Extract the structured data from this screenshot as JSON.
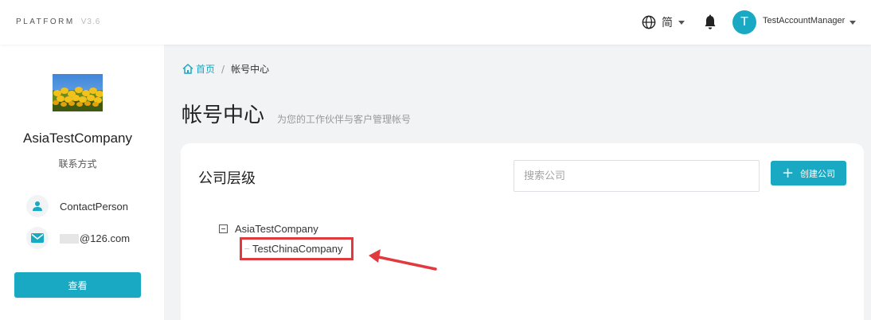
{
  "header": {
    "brand": "PLATFORM",
    "version": "V3.6",
    "language": "简",
    "language_icon": "globe-icon",
    "notification_icon": "bell-icon",
    "avatar_initial": "T",
    "username": "TestAccountManager"
  },
  "sidebar": {
    "company_name": "AsiaTestCompany",
    "contact_title": "联系方式",
    "contact_person": "ContactPerson",
    "email": "@126.com",
    "view_button": "查看",
    "person_icon": "person-icon",
    "email_icon": "mail-icon"
  },
  "breadcrumb": {
    "home": "首页",
    "separator": "/",
    "current": "帐号中心"
  },
  "page": {
    "title": "帐号中心",
    "subtitle": "为您的工作伙伴与客户管理帐号"
  },
  "card": {
    "title": "公司层级",
    "search_placeholder": "搜索公司",
    "create_button": "创建公司"
  },
  "tree": {
    "root": "AsiaTestCompany",
    "child": "TestChinaCompany"
  },
  "colors": {
    "accent": "#1aa9c2",
    "highlight": "#e0393e"
  }
}
